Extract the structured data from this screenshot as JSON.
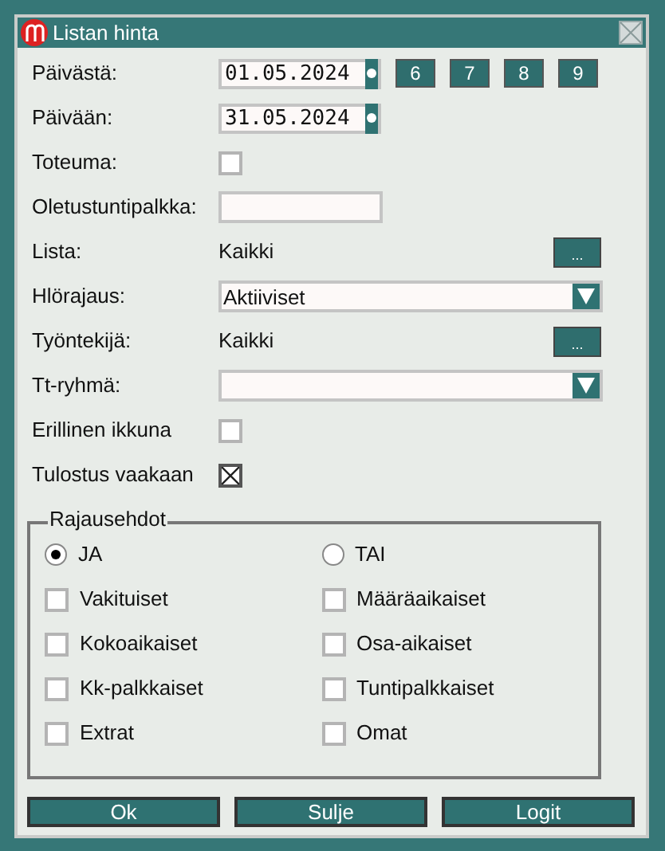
{
  "window": {
    "title": "Listan hinta"
  },
  "fields": [
    {
      "kind": "date",
      "label": "Päivästä:",
      "value": "01.05.2024",
      "buttons": [
        "6",
        "7",
        "8",
        "9"
      ]
    },
    {
      "kind": "date",
      "label": "Päivään:",
      "value": "31.05.2024"
    },
    {
      "kind": "checkbox",
      "label": "Toteuma:",
      "checked": false
    },
    {
      "kind": "input",
      "label": "Oletustuntipalkka:"
    },
    {
      "kind": "picker",
      "label": "Lista:",
      "value": "Kaikki",
      "button": "..."
    },
    {
      "kind": "select",
      "label": "Hlörajaus:",
      "value": "Aktiiviset"
    },
    {
      "kind": "picker",
      "label": "Työntekijä:",
      "value": "Kaikki",
      "button": "..."
    },
    {
      "kind": "select",
      "label": "Tt-ryhmä:"
    },
    {
      "kind": "checkbox",
      "label": "Erillinen ikkuna",
      "checked": false
    },
    {
      "kind": "checkbox",
      "label": "Tulostus vaakaan",
      "checked": true
    }
  ],
  "group": {
    "title": "Rajausehdot",
    "options": [
      {
        "kind": "radio",
        "label": "JA",
        "selected": true
      },
      {
        "kind": "radio",
        "label": "TAI",
        "selected": false
      },
      {
        "kind": "checkbox",
        "label": "Vakituiset",
        "checked": false
      },
      {
        "kind": "checkbox",
        "label": "Määräaikaiset",
        "checked": false
      },
      {
        "kind": "checkbox",
        "label": "Kokoaikaiset",
        "checked": false
      },
      {
        "kind": "checkbox",
        "label": "Osa-aikaiset",
        "checked": false
      },
      {
        "kind": "checkbox",
        "label": "Kk-palkkaiset",
        "checked": false
      },
      {
        "kind": "checkbox",
        "label": "Tuntipalkkaiset",
        "checked": false
      },
      {
        "kind": "checkbox",
        "label": "Extrat",
        "checked": false
      },
      {
        "kind": "checkbox",
        "label": "Omat",
        "checked": false
      }
    ]
  },
  "buttons": [
    "Ok",
    "Sulje",
    "Logit"
  ]
}
